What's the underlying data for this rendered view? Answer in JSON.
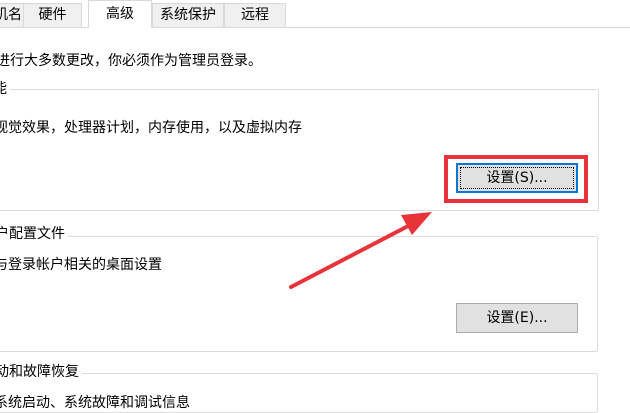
{
  "tabs": [
    {
      "label": "机名"
    },
    {
      "label": "硬件"
    },
    {
      "label": "高级",
      "active": true
    },
    {
      "label": "系统保护"
    },
    {
      "label": "远程"
    }
  ],
  "admin_notice": "进行大多数更改，你必须作为管理员登录。",
  "performance": {
    "title": "能",
    "description": "视觉效果，处理器计划，内存使用，以及虚拟内存",
    "button_label": "设置(S)..."
  },
  "user_profiles": {
    "title": "户配置文件",
    "description": "与登录帐户相关的桌面设置",
    "button_label": "设置(E)..."
  },
  "startup_recovery": {
    "title": "动和故障恢复",
    "description": "系统启动、系统故障和调试信息"
  },
  "annotation": {
    "highlight_color": "#e8333a",
    "arrow_color": "#e8333a"
  },
  "colors": {
    "focus_border": "#0078d7",
    "button_bg": "#e1e1e1"
  }
}
